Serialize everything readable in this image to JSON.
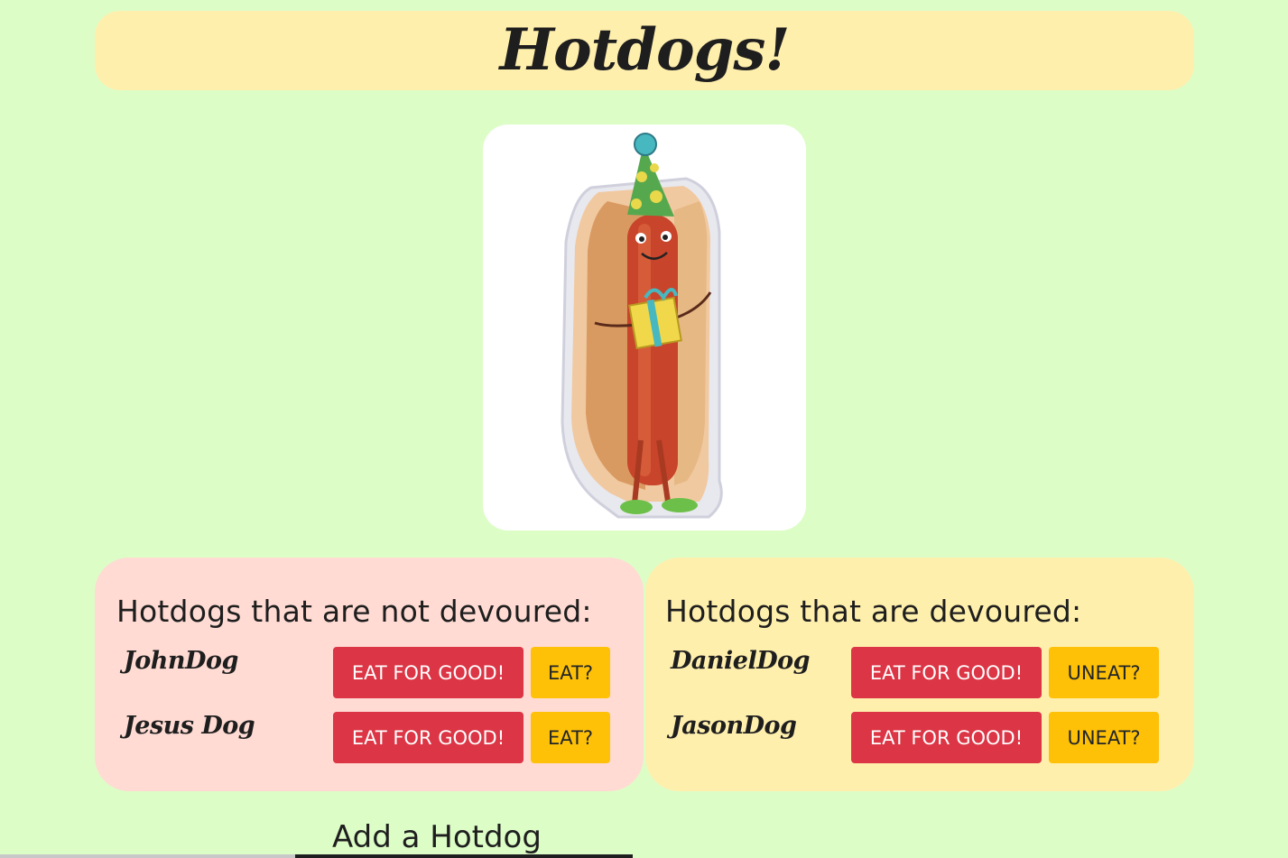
{
  "header": {
    "title": "Hotdogs!"
  },
  "hero_image": {
    "alt": "Cartoon hotdog wearing party hat holding a present"
  },
  "not_devoured": {
    "heading": "Hotdogs that are not devoured:",
    "items": [
      {
        "name": "JohnDog",
        "eat_for_good_label": "EAT FOR GOOD!",
        "toggle_label": "EAT?"
      },
      {
        "name": "Jesus Dog",
        "eat_for_good_label": "EAT FOR GOOD!",
        "toggle_label": "EAT?"
      }
    ]
  },
  "devoured": {
    "heading": "Hotdogs that are devoured:",
    "items": [
      {
        "name": "DanielDog",
        "eat_for_good_label": "EAT FOR GOOD!",
        "toggle_label": "UNEAT?"
      },
      {
        "name": "JasonDog",
        "eat_for_good_label": "EAT FOR GOOD!",
        "toggle_label": "UNEAT?"
      }
    ]
  },
  "add_section": {
    "title": "Add a Hotdog"
  },
  "colors": {
    "page_bg": "#ddfdc7",
    "header_bg": "#ffefad",
    "not_devoured_bg": "#ffdbd3",
    "devoured_bg": "#ffefad",
    "danger": "#dc3545",
    "warning": "#ffc107"
  }
}
